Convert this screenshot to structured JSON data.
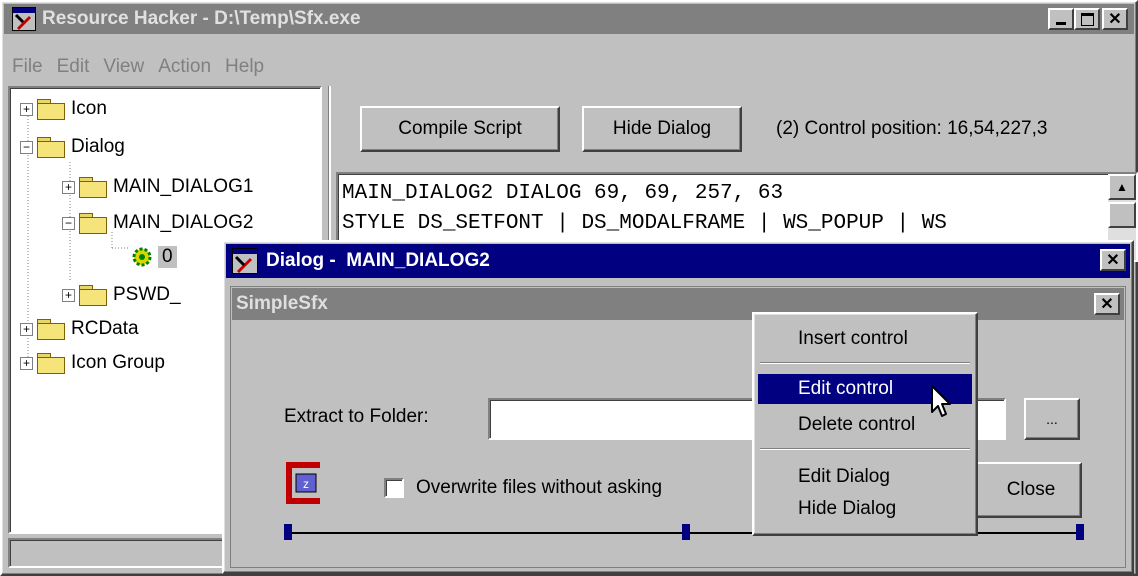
{
  "main_window": {
    "title": "Resource Hacker  -  D:\\Temp\\Sfx.exe",
    "menu": [
      "File",
      "Edit",
      "View",
      "Action",
      "Help"
    ]
  },
  "tree": {
    "items": [
      {
        "label": "Icon",
        "expander": "+"
      },
      {
        "label": "Dialog",
        "expander": "−"
      },
      {
        "label": "MAIN_DIALOG1",
        "expander": "+"
      },
      {
        "label": "MAIN_DIALOG2",
        "expander": "−"
      },
      {
        "label": "0"
      },
      {
        "label": "PSWD_",
        "expander": "+"
      },
      {
        "label": "RCData",
        "expander": "+"
      },
      {
        "label": "Icon Group",
        "expander": "+"
      }
    ]
  },
  "toolbar": {
    "compile_label": "Compile Script",
    "hide_dialog_label": "Hide Dialog",
    "status": "(2)  Control position: 16,54,227,3"
  },
  "script": {
    "line1": "MAIN_DIALOG2 DIALOG 69, 69, 257, 63",
    "line2": "STYLE DS_SETFONT | DS_MODALFRAME | WS_POPUP | WS"
  },
  "dialog_window": {
    "title": "Dialog -  MAIN_DIALOG2"
  },
  "preview": {
    "title": "SimpleSfx",
    "extract_label": "Extract to Folder:",
    "browse_label": "...",
    "overwrite_label": "Overwrite files without asking",
    "close_label": "Close"
  },
  "context_menu": {
    "items": [
      "Insert control",
      "Edit control",
      "Delete control",
      "Edit Dialog",
      "Hide Dialog"
    ],
    "selected": "Edit control"
  },
  "colors": {
    "active_title": "#000080",
    "inactive_title": "#808080",
    "face": "#c0c0c0",
    "selection": "#000080"
  }
}
